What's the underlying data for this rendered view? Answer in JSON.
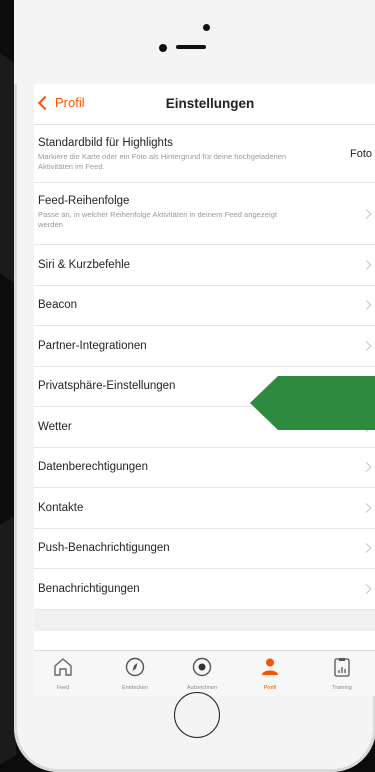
{
  "nav": {
    "back_label": "Profil",
    "title": "Einstellungen"
  },
  "settings": [
    {
      "label": "Standardbild für Highlights",
      "description": "Markiere die Karte oder ein Foto als Hintergrund für deine hochgeladenen Aktivitäten im Feed.",
      "value": "Foto"
    },
    {
      "label": "Feed-Reihenfolge",
      "description": "Passe an, in welcher Reihenfolge Aktivitäten in deinem Feed angezeigt werden"
    },
    {
      "label": "Siri & Kurzbefehle"
    },
    {
      "label": "Beacon"
    },
    {
      "label": "Partner-Integrationen"
    },
    {
      "label": "Privatsphäre-Einstellungen"
    },
    {
      "label": "Wetter"
    },
    {
      "label": "Datenberechtigungen"
    },
    {
      "label": "Kontakte"
    },
    {
      "label": "Push-Benachrichtigungen"
    },
    {
      "label": "Benachrichtigungen"
    }
  ],
  "tabs": [
    {
      "icon": "home-icon",
      "label": "Feed"
    },
    {
      "icon": "compass-icon",
      "label": "Entdecken"
    },
    {
      "icon": "record-icon",
      "label": "Aufzeichnen"
    },
    {
      "icon": "profile-icon",
      "label": "Profil",
      "active": true
    },
    {
      "icon": "training-log-icon",
      "label": "Training"
    }
  ],
  "colors": {
    "accent": "#fc5200",
    "highlight_arrow": "#2e8a3e"
  }
}
